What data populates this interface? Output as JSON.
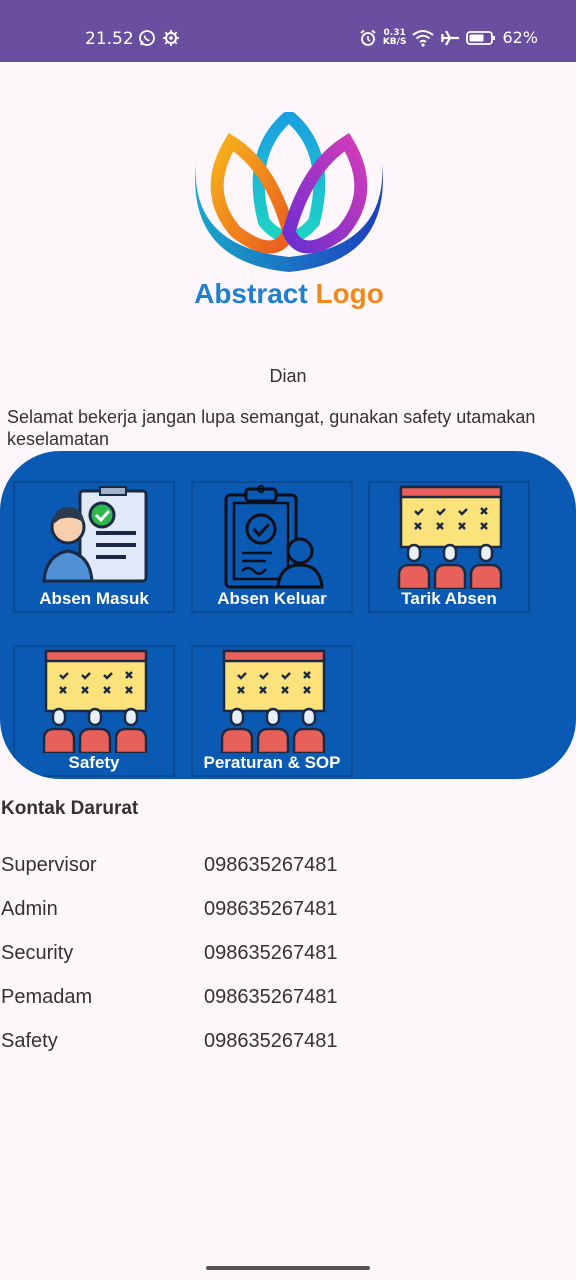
{
  "status_bar": {
    "time": "21.52",
    "net_speed_value": "0.31",
    "net_speed_unit": "KB/S",
    "battery": "62%",
    "bg_color": "#6a4ea0"
  },
  "logo": {
    "word1": "Abstract",
    "word2": "Logo"
  },
  "user": {
    "name": "Dian"
  },
  "greeting": "Selamat bekerja jangan lupa semangat, gunakan safety utamakan keselamatan",
  "menu": {
    "bg_color": "#0a5ab4",
    "items": [
      {
        "label": "Absen Masuk",
        "icon": "check-in-icon"
      },
      {
        "label": "Absen Keluar",
        "icon": "clipboard-user-icon"
      },
      {
        "label": "Tarik Absen",
        "icon": "calendar-people-icon"
      },
      {
        "label": "Safety",
        "icon": "calendar-people-icon"
      },
      {
        "label": "Peraturan & SOP",
        "icon": "calendar-people-icon"
      }
    ]
  },
  "emergency": {
    "title": "Kontak Darurat",
    "contacts": [
      {
        "role": "Supervisor",
        "phone": "098635267481"
      },
      {
        "role": "Admin",
        "phone": "098635267481"
      },
      {
        "role": "Security",
        "phone": "098635267481"
      },
      {
        "role": "Pemadam",
        "phone": "098635267481"
      },
      {
        "role": "Safety",
        "phone": "098635267481"
      }
    ]
  }
}
